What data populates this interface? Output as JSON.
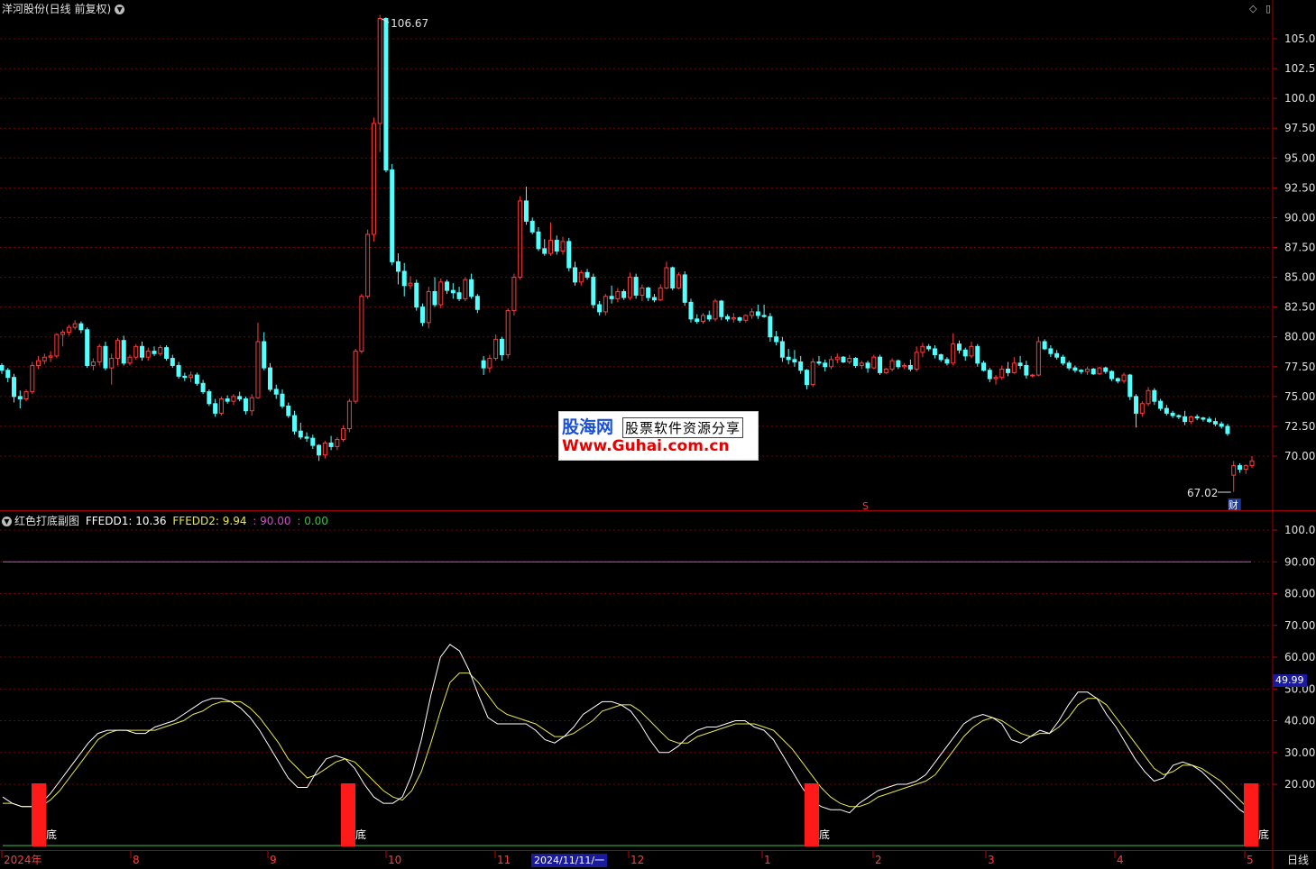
{
  "header": {
    "title": "洋河股份(日线 前复权)",
    "controls": [
      "◇",
      "▯"
    ]
  },
  "indicator": {
    "name": "红色打底副图",
    "line1_label": "FFEDD1: 10.36",
    "line2_label": "FFEDD2: 9.94",
    "level_high": ": 90.00",
    "level_low": ": 0.00",
    "current_value": "49.99",
    "signal_label": "底",
    "colors": {
      "line1": "#ffffff",
      "line2": "#e8e84a",
      "level_high": "#d04ed0",
      "level_low": "#3fbf3f",
      "signal": "#ff1a1a"
    }
  },
  "price_axis": [
    "105.0",
    "102.5",
    "100.0",
    "97.50",
    "95.00",
    "92.50",
    "90.00",
    "87.50",
    "85.00",
    "82.50",
    "80.00",
    "77.50",
    "75.00",
    "72.50",
    "70.00"
  ],
  "indicator_axis": [
    "100.0",
    "90.00",
    "80.00",
    "70.00",
    "60.00",
    "50.00",
    "40.00",
    "30.00",
    "20.00"
  ],
  "annotations": {
    "high_label": "106.67",
    "low_label": "67.02",
    "finance_marker": "财",
    "s_marker": "S"
  },
  "time_axis": [
    "2024年",
    "8",
    "9",
    "10",
    "11",
    "12",
    "1",
    "2",
    "3",
    "4",
    "5"
  ],
  "cursor_date": "2024/11/11/一",
  "period": "日线",
  "watermark": {
    "top_brand": "股海网",
    "top_slogan": "股票软件资源分享",
    "url": "Www.Guhai.com.cn"
  },
  "colors": {
    "up": "#ff3b3b",
    "down": "#54ffff",
    "grid": "#7a0000",
    "axis_text": "#e0e0e0"
  },
  "chart_data": {
    "type": "candlestick",
    "ylim": [
      67.0,
      107.5
    ],
    "ohlc": [
      [
        77.6,
        77.8,
        76.9,
        77.2
      ],
      [
        77.2,
        77.4,
        76.2,
        76.6
      ],
      [
        76.6,
        76.9,
        74.5,
        75.0
      ],
      [
        75.0,
        75.5,
        74.0,
        74.8
      ],
      [
        74.8,
        75.6,
        74.6,
        75.4
      ],
      [
        75.4,
        77.9,
        75.2,
        77.6
      ],
      [
        77.6,
        78.4,
        77.3,
        78.0
      ],
      [
        78.0,
        78.6,
        77.7,
        78.3
      ],
      [
        78.3,
        78.8,
        77.9,
        78.4
      ],
      [
        78.4,
        80.3,
        78.2,
        80.2
      ],
      [
        80.2,
        80.6,
        79.2,
        80.4
      ],
      [
        80.4,
        81.0,
        80.1,
        80.8
      ],
      [
        80.8,
        81.4,
        80.6,
        81.1
      ],
      [
        81.1,
        81.3,
        80.3,
        80.6
      ],
      [
        80.6,
        80.8,
        77.4,
        77.6
      ],
      [
        77.6,
        78.2,
        77.2,
        77.9
      ],
      [
        77.9,
        79.4,
        77.6,
        79.2
      ],
      [
        79.2,
        79.6,
        77.2,
        77.4
      ],
      [
        77.4,
        78.6,
        76.0,
        78.2
      ],
      [
        78.2,
        79.9,
        77.6,
        79.7
      ],
      [
        79.7,
        80.1,
        77.6,
        77.8
      ],
      [
        77.8,
        78.5,
        77.6,
        78.3
      ],
      [
        78.3,
        79.4,
        78.1,
        79.2
      ],
      [
        79.2,
        79.6,
        78.0,
        78.3
      ],
      [
        78.3,
        79.1,
        78.0,
        78.8
      ],
      [
        78.8,
        79.2,
        78.4,
        78.6
      ],
      [
        78.6,
        79.3,
        78.4,
        79.1
      ],
      [
        79.1,
        79.3,
        78.0,
        78.2
      ],
      [
        78.2,
        78.5,
        77.4,
        77.6
      ],
      [
        77.6,
        77.9,
        76.5,
        76.7
      ],
      [
        76.7,
        77.0,
        76.3,
        76.6
      ],
      [
        76.6,
        77.1,
        76.2,
        76.8
      ],
      [
        76.8,
        77.0,
        75.9,
        76.1
      ],
      [
        76.1,
        76.4,
        75.2,
        75.4
      ],
      [
        75.4,
        75.6,
        74.2,
        74.4
      ],
      [
        74.4,
        74.8,
        73.3,
        73.6
      ],
      [
        73.6,
        75.0,
        73.4,
        74.8
      ],
      [
        74.8,
        75.1,
        74.4,
        74.6
      ],
      [
        74.6,
        75.2,
        74.3,
        75.0
      ],
      [
        75.0,
        75.4,
        74.6,
        74.8
      ],
      [
        74.8,
        75.0,
        73.5,
        73.8
      ],
      [
        73.8,
        75.2,
        73.4,
        74.9
      ],
      [
        74.9,
        81.2,
        74.8,
        79.6
      ],
      [
        79.6,
        80.4,
        77.2,
        77.4
      ],
      [
        77.4,
        77.8,
        75.4,
        75.6
      ],
      [
        75.6,
        76.0,
        74.8,
        75.2
      ],
      [
        75.2,
        75.6,
        74.0,
        74.2
      ],
      [
        74.2,
        74.5,
        73.2,
        73.4
      ],
      [
        73.4,
        73.8,
        71.8,
        72.1
      ],
      [
        72.1,
        72.8,
        71.4,
        71.6
      ],
      [
        71.6,
        72.0,
        71.2,
        71.5
      ],
      [
        71.5,
        71.8,
        70.6,
        70.9
      ],
      [
        70.9,
        71.0,
        69.6,
        70.1
      ],
      [
        70.1,
        71.3,
        69.8,
        71.1
      ],
      [
        71.1,
        71.7,
        70.5,
        70.8
      ],
      [
        70.8,
        71.6,
        70.5,
        71.4
      ],
      [
        71.4,
        72.6,
        71.2,
        72.3
      ],
      [
        72.3,
        74.8,
        72.0,
        74.6
      ],
      [
        74.6,
        79.0,
        74.4,
        78.8
      ],
      [
        78.8,
        83.6,
        78.6,
        83.4
      ],
      [
        83.4,
        89.0,
        83.2,
        88.6
      ],
      [
        88.6,
        98.4,
        88.0,
        97.9
      ],
      [
        97.9,
        107.0,
        95.5,
        106.7
      ],
      [
        106.7,
        106.8,
        93.8,
        94.0
      ],
      [
        94.0,
        94.5,
        86.0,
        86.3
      ],
      [
        86.3,
        87.0,
        84.4,
        85.5
      ],
      [
        85.5,
        86.2,
        83.4,
        84.3
      ],
      [
        84.3,
        85.1,
        84.0,
        84.5
      ],
      [
        84.5,
        84.8,
        82.2,
        82.5
      ],
      [
        82.5,
        82.8,
        80.9,
        81.2
      ],
      [
        81.2,
        84.2,
        80.7,
        83.8
      ],
      [
        83.8,
        85.0,
        82.5,
        82.7
      ],
      [
        82.7,
        84.9,
        82.4,
        84.6
      ],
      [
        84.6,
        84.8,
        83.6,
        83.9
      ],
      [
        83.9,
        84.5,
        83.2,
        83.7
      ],
      [
        83.7,
        84.2,
        83.0,
        83.2
      ],
      [
        83.2,
        85.0,
        83.0,
        84.8
      ],
      [
        84.8,
        85.3,
        83.2,
        83.4
      ],
      [
        83.4,
        83.6,
        82.0,
        82.3
      ],
      [
        78.0,
        78.4,
        76.8,
        77.4
      ],
      [
        77.4,
        78.5,
        77.0,
        78.2
      ],
      [
        78.2,
        80.2,
        78.0,
        79.8
      ],
      [
        79.8,
        80.0,
        78.0,
        78.5
      ],
      [
        78.5,
        82.4,
        78.2,
        82.2
      ],
      [
        82.2,
        85.3,
        81.8,
        85.0
      ],
      [
        85.0,
        91.8,
        84.8,
        91.4
      ],
      [
        91.4,
        92.6,
        89.4,
        89.7
      ],
      [
        89.7,
        90.0,
        88.6,
        88.8
      ],
      [
        88.8,
        89.2,
        87.2,
        87.4
      ],
      [
        87.4,
        88.2,
        86.8,
        87.0
      ],
      [
        87.0,
        89.6,
        86.8,
        88.1
      ],
      [
        88.1,
        88.5,
        86.9,
        87.2
      ],
      [
        87.2,
        88.4,
        86.9,
        88.0
      ],
      [
        88.0,
        88.3,
        85.5,
        85.8
      ],
      [
        85.8,
        86.3,
        84.3,
        84.6
      ],
      [
        84.6,
        85.6,
        84.3,
        85.4
      ],
      [
        85.4,
        85.7,
        84.8,
        85.0
      ],
      [
        85.0,
        85.3,
        82.4,
        82.7
      ],
      [
        82.7,
        83.0,
        81.8,
        82.1
      ],
      [
        82.1,
        83.6,
        81.8,
        83.4
      ],
      [
        83.4,
        84.3,
        82.8,
        83.2
      ],
      [
        83.2,
        84.1,
        82.9,
        83.8
      ],
      [
        83.8,
        84.0,
        83.1,
        83.3
      ],
      [
        83.3,
        85.4,
        83.1,
        85.0
      ],
      [
        85.0,
        85.3,
        83.2,
        83.5
      ],
      [
        83.5,
        84.4,
        83.0,
        84.1
      ],
      [
        84.1,
        84.2,
        83.0,
        83.3
      ],
      [
        83.3,
        83.6,
        82.9,
        83.1
      ],
      [
        83.1,
        84.4,
        83.0,
        84.1
      ],
      [
        84.1,
        86.3,
        84.0,
        85.8
      ],
      [
        85.8,
        85.9,
        83.9,
        84.1
      ],
      [
        84.1,
        85.4,
        84.0,
        85.2
      ],
      [
        85.2,
        85.5,
        82.6,
        82.9
      ],
      [
        82.9,
        83.2,
        81.2,
        81.5
      ],
      [
        81.5,
        81.9,
        81.1,
        81.3
      ],
      [
        81.3,
        82.0,
        81.1,
        81.8
      ],
      [
        81.8,
        82.2,
        81.3,
        81.5
      ],
      [
        81.5,
        83.2,
        81.3,
        83.0
      ],
      [
        83.0,
        83.1,
        81.4,
        81.7
      ],
      [
        81.7,
        81.9,
        81.3,
        81.5
      ],
      [
        81.5,
        82.0,
        81.2,
        81.6
      ],
      [
        81.6,
        81.7,
        81.2,
        81.4
      ],
      [
        81.4,
        81.9,
        81.2,
        81.8
      ],
      [
        81.8,
        82.4,
        81.5,
        82.1
      ],
      [
        82.1,
        82.7,
        81.5,
        81.8
      ],
      [
        81.8,
        82.7,
        81.6,
        81.7
      ],
      [
        81.7,
        82.0,
        79.6,
        80.0
      ],
      [
        80.0,
        80.5,
        79.3,
        79.6
      ],
      [
        79.6,
        80.0,
        77.9,
        78.3
      ],
      [
        78.3,
        79.0,
        77.7,
        78.1
      ],
      [
        78.1,
        78.9,
        77.5,
        77.9
      ],
      [
        77.9,
        78.4,
        76.9,
        77.2
      ],
      [
        77.2,
        77.3,
        75.6,
        76.0
      ],
      [
        76.0,
        78.2,
        75.8,
        77.9
      ],
      [
        77.9,
        78.4,
        77.6,
        77.8
      ],
      [
        77.8,
        78.1,
        77.1,
        77.5
      ],
      [
        77.5,
        78.4,
        77.3,
        78.1
      ],
      [
        78.1,
        78.6,
        77.8,
        78.3
      ],
      [
        78.3,
        78.4,
        77.8,
        77.9
      ],
      [
        77.9,
        78.5,
        77.7,
        78.2
      ],
      [
        78.2,
        78.3,
        77.4,
        77.6
      ],
      [
        77.6,
        78.0,
        77.3,
        77.8
      ],
      [
        77.8,
        78.0,
        77.0,
        77.4
      ],
      [
        77.4,
        78.5,
        77.3,
        78.3
      ],
      [
        78.3,
        78.5,
        76.8,
        77.0
      ],
      [
        77.0,
        77.4,
        76.9,
        77.3
      ],
      [
        77.3,
        78.2,
        77.1,
        78.0
      ],
      [
        78.0,
        78.1,
        77.3,
        77.5
      ],
      [
        77.5,
        77.8,
        77.3,
        77.6
      ],
      [
        77.6,
        78.1,
        77.1,
        77.3
      ],
      [
        77.3,
        79.2,
        77.1,
        78.7
      ],
      [
        78.7,
        79.5,
        78.3,
        79.2
      ],
      [
        79.2,
        79.4,
        78.8,
        79.0
      ],
      [
        79.0,
        79.3,
        78.2,
        78.5
      ],
      [
        78.5,
        78.6,
        77.9,
        78.1
      ],
      [
        78.1,
        78.3,
        77.6,
        77.8
      ],
      [
        77.8,
        80.3,
        77.6,
        79.4
      ],
      [
        79.4,
        79.7,
        78.6,
        78.9
      ],
      [
        78.9,
        79.1,
        78.0,
        78.4
      ],
      [
        78.4,
        79.6,
        78.2,
        79.2
      ],
      [
        79.2,
        79.4,
        77.5,
        77.8
      ],
      [
        77.8,
        78.0,
        77.1,
        77.2
      ],
      [
        77.2,
        77.4,
        76.2,
        76.5
      ],
      [
        76.5,
        76.8,
        76.0,
        76.6
      ],
      [
        76.6,
        77.6,
        76.4,
        77.3
      ],
      [
        77.3,
        77.9,
        76.7,
        77.0
      ],
      [
        77.0,
        78.3,
        76.9,
        77.8
      ],
      [
        77.8,
        78.4,
        77.3,
        77.6
      ],
      [
        77.6,
        78.0,
        76.5,
        76.8
      ],
      [
        76.8,
        76.9,
        76.6,
        76.8
      ],
      [
        76.8,
        80.0,
        76.7,
        79.6
      ],
      [
        79.6,
        79.8,
        78.9,
        79.0
      ],
      [
        79.0,
        79.3,
        78.3,
        78.6
      ],
      [
        78.6,
        78.9,
        78.1,
        78.3
      ],
      [
        78.3,
        78.5,
        77.6,
        77.8
      ],
      [
        77.8,
        78.0,
        77.2,
        77.4
      ],
      [
        77.4,
        77.6,
        77.0,
        77.2
      ],
      [
        77.2,
        77.3,
        76.9,
        77.1
      ],
      [
        77.1,
        77.5,
        76.8,
        77.3
      ],
      [
        77.3,
        77.4,
        76.8,
        76.9
      ],
      [
        76.9,
        77.5,
        76.8,
        77.4
      ],
      [
        77.4,
        77.5,
        76.9,
        77.1
      ],
      [
        77.1,
        77.2,
        76.3,
        76.5
      ],
      [
        76.5,
        76.6,
        76.1,
        76.3
      ],
      [
        76.3,
        77.0,
        76.1,
        76.8
      ],
      [
        76.8,
        76.9,
        74.7,
        75.0
      ],
      [
        75.0,
        75.2,
        72.4,
        73.6
      ],
      [
        73.6,
        74.6,
        73.3,
        74.4
      ],
      [
        74.4,
        75.8,
        74.2,
        75.5
      ],
      [
        75.5,
        75.7,
        74.3,
        74.6
      ],
      [
        74.6,
        74.8,
        73.8,
        74.0
      ],
      [
        74.0,
        74.3,
        73.4,
        73.6
      ],
      [
        73.6,
        73.8,
        73.2,
        73.4
      ],
      [
        73.4,
        73.5,
        73.1,
        73.3
      ],
      [
        73.3,
        73.8,
        72.6,
        72.9
      ],
      [
        72.9,
        73.4,
        72.7,
        73.3
      ],
      [
        73.3,
        73.5,
        73.0,
        73.2
      ],
      [
        73.2,
        73.3,
        72.9,
        73.1
      ],
      [
        73.1,
        73.3,
        72.8,
        72.9
      ],
      [
        72.9,
        73.2,
        72.5,
        72.7
      ],
      [
        72.7,
        72.9,
        72.3,
        72.5
      ],
      [
        72.5,
        72.7,
        71.7,
        71.9
      ],
      [
        68.4,
        69.6,
        67.0,
        69.2
      ],
      [
        69.2,
        69.4,
        68.6,
        68.9
      ],
      [
        68.9,
        69.3,
        68.5,
        69.2
      ],
      [
        69.2,
        70.0,
        69.0,
        69.6
      ]
    ],
    "ffedd1": [
      16,
      14,
      13,
      13,
      14,
      17,
      21,
      25,
      29,
      33,
      36,
      37,
      37,
      37,
      36,
      36,
      38,
      39,
      40,
      42,
      44,
      46,
      47,
      47,
      46,
      44,
      41,
      37,
      32,
      27,
      22,
      19,
      19,
      24,
      28,
      29,
      28,
      25,
      20,
      16,
      14,
      14,
      16,
      23,
      34,
      48,
      60,
      64,
      62,
      56,
      48,
      41,
      39,
      39,
      39,
      39,
      37,
      34,
      33,
      35,
      38,
      42,
      44,
      46,
      46,
      45,
      43,
      39,
      34,
      30,
      30,
      32,
      35,
      37,
      38,
      38,
      39,
      40,
      40,
      38,
      37,
      34,
      29,
      24,
      19,
      15,
      13,
      12,
      12,
      11,
      14,
      16,
      18,
      19,
      20,
      20,
      21,
      23,
      27,
      31,
      35,
      39,
      41,
      42,
      41,
      39,
      34,
      33,
      35,
      37,
      36,
      40,
      45,
      49,
      49,
      47,
      42,
      38,
      33,
      28,
      24,
      21,
      22,
      26,
      27,
      26,
      24,
      21,
      18,
      15,
      12,
      10
    ],
    "ffedd2": [
      14,
      14,
      13,
      13,
      13,
      15,
      18,
      22,
      26,
      30,
      34,
      36,
      37,
      37,
      37,
      37,
      37,
      38,
      39,
      40,
      42,
      43,
      45,
      46,
      46,
      46,
      44,
      41,
      37,
      33,
      28,
      25,
      22,
      23,
      25,
      27,
      28,
      27,
      24,
      21,
      18,
      16,
      15,
      18,
      24,
      33,
      43,
      52,
      55,
      55,
      52,
      48,
      44,
      42,
      41,
      40,
      39,
      37,
      35,
      35,
      36,
      38,
      40,
      43,
      44,
      45,
      45,
      43,
      40,
      37,
      34,
      33,
      33,
      35,
      36,
      37,
      38,
      39,
      39,
      39,
      38,
      37,
      34,
      31,
      27,
      23,
      19,
      16,
      14,
      13,
      13,
      14,
      16,
      17,
      18,
      19,
      20,
      21,
      23,
      27,
      31,
      35,
      38,
      40,
      41,
      40,
      38,
      36,
      35,
      36,
      36,
      38,
      41,
      45,
      47,
      47,
      45,
      41,
      37,
      33,
      29,
      25,
      23,
      24,
      26,
      26,
      25,
      23,
      21,
      18,
      15,
      12
    ]
  }
}
